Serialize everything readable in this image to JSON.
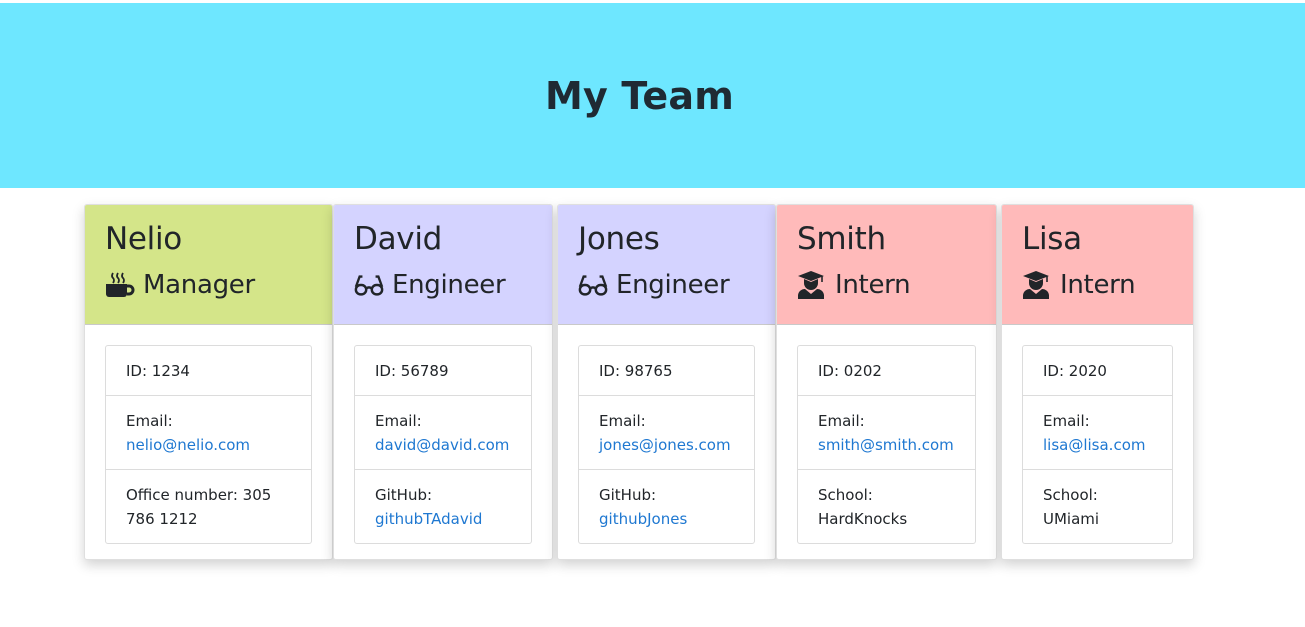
{
  "header": {
    "title": "My Team"
  },
  "cards": [
    {
      "name": "Nelio",
      "role": "Manager",
      "icon": "mug-icon",
      "id_label": "ID: 1234",
      "email_label": "Email:",
      "email": "nelio@nelio.com",
      "extra_text": "Office number: 305 786 1212"
    },
    {
      "name": "David",
      "role": "Engineer",
      "icon": "glasses-icon",
      "id_label": "ID: 56789",
      "email_label": "Email:",
      "email": "david@david.com",
      "extra_label": "GitHub:",
      "extra_value": "githubTAdavid"
    },
    {
      "name": "Jones",
      "role": "Engineer",
      "icon": "glasses-icon",
      "id_label": "ID: 98765",
      "email_label": "Email:",
      "email": "jones@jones.com",
      "extra_label": "GitHub:",
      "extra_value": "githubJones"
    },
    {
      "name": "Smith",
      "role": "Intern",
      "icon": "graduate-icon",
      "id_label": "ID: 0202",
      "email_label": "Email:",
      "email": "smith@smith.com",
      "extra_label": "School:",
      "extra_value": "HardKnocks"
    },
    {
      "name": "Lisa",
      "role": "Intern",
      "icon": "graduate-icon",
      "id_label": "ID: 2020",
      "email_label": "Email:",
      "email": "lisa@lisa.com",
      "extra_label": "School:",
      "extra_value": "UMiami"
    }
  ],
  "colors": {
    "header_bg": "#6ee7ff",
    "manager": "#d4e589",
    "engineer": "#d4d3ff",
    "intern": "#ffbaba",
    "link": "#1f78d1"
  }
}
